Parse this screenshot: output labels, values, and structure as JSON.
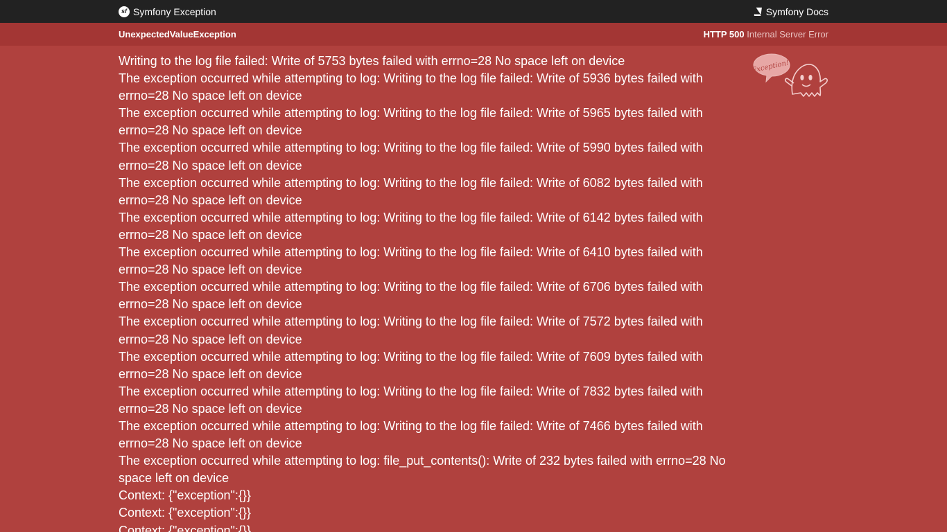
{
  "topbar": {
    "brand_label": "Symfony Exception",
    "docs_label": "Symfony Docs"
  },
  "subbar": {
    "exception_class": "UnexpectedValueException",
    "status_code": "HTTP 500",
    "status_text": "Internal Server Error"
  },
  "illustration": {
    "bubble_text": "Exception!"
  },
  "messages": [
    "Writing to the log file failed: Write of 5753 bytes failed with errno=28 No space left on device",
    "The exception occurred while attempting to log: Writing to the log file failed: Write of 5936 bytes failed with errno=28 No space left on device",
    "The exception occurred while attempting to log: Writing to the log file failed: Write of 5965 bytes failed with errno=28 No space left on device",
    "The exception occurred while attempting to log: Writing to the log file failed: Write of 5990 bytes failed with errno=28 No space left on device",
    "The exception occurred while attempting to log: Writing to the log file failed: Write of 6082 bytes failed with errno=28 No space left on device",
    "The exception occurred while attempting to log: Writing to the log file failed: Write of 6142 bytes failed with errno=28 No space left on device",
    "The exception occurred while attempting to log: Writing to the log file failed: Write of 6410 bytes failed with errno=28 No space left on device",
    "The exception occurred while attempting to log: Writing to the log file failed: Write of 6706 bytes failed with errno=28 No space left on device",
    "The exception occurred while attempting to log: Writing to the log file failed: Write of 7572 bytes failed with errno=28 No space left on device",
    "The exception occurred while attempting to log: Writing to the log file failed: Write of 7609 bytes failed with errno=28 No space left on device",
    "The exception occurred while attempting to log: Writing to the log file failed: Write of 7832 bytes failed with errno=28 No space left on device",
    "The exception occurred while attempting to log: Writing to the log file failed: Write of 7466 bytes failed with errno=28 No space left on device",
    "The exception occurred while attempting to log: file_put_contents(): Write of 232 bytes failed with errno=28 No space left on device",
    "Context: {\"exception\":{}}",
    "Context: {\"exception\":{}}",
    "Context: {\"exception\":{}}"
  ],
  "colors": {
    "topbar_bg": "#222222",
    "subbar_bg": "#a33634",
    "page_bg": "#b0413e",
    "text": "#ffffff"
  }
}
